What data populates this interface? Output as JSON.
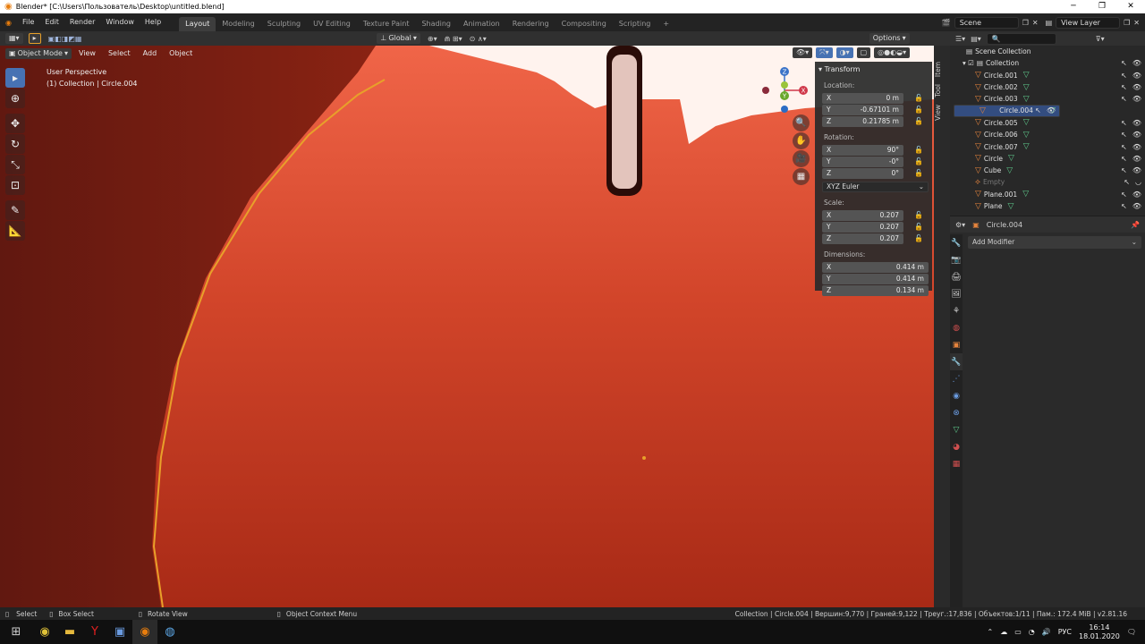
{
  "window": {
    "title": "Blender* [C:\\Users\\Пользователь\\Desktop\\untitled.blend]"
  },
  "menu": [
    "File",
    "Edit",
    "Render",
    "Window",
    "Help"
  ],
  "workspaces": [
    "Layout",
    "Modeling",
    "Sculpting",
    "UV Editing",
    "Texture Paint",
    "Shading",
    "Animation",
    "Rendering",
    "Compositing",
    "Scripting"
  ],
  "active_workspace": "Layout",
  "header_right": {
    "scene": "Scene",
    "view_layer": "View Layer"
  },
  "tool_header": {
    "orientation": "Global",
    "options": "Options"
  },
  "viewport": {
    "mode": "Object Mode",
    "menus": [
      "View",
      "Select",
      "Add",
      "Object"
    ],
    "info_line1": "User Perspective",
    "info_line2": "(1) Collection | Circle.004"
  },
  "gizmo": {
    "z": "Z",
    "y": "Y",
    "x": "X"
  },
  "npanel": {
    "title": "Transform",
    "location_label": "Location:",
    "location": [
      {
        "axis": "X",
        "value": "0 m"
      },
      {
        "axis": "Y",
        "value": "-0.67101 m"
      },
      {
        "axis": "Z",
        "value": "0.21785 m"
      }
    ],
    "rotation_label": "Rotation:",
    "rotation": [
      {
        "axis": "X",
        "value": "90°"
      },
      {
        "axis": "Y",
        "value": "-0°"
      },
      {
        "axis": "Z",
        "value": "0°"
      }
    ],
    "rotation_mode": "XYZ Euler",
    "scale_label": "Scale:",
    "scale": [
      {
        "axis": "X",
        "value": "0.207"
      },
      {
        "axis": "Y",
        "value": "0.207"
      },
      {
        "axis": "Z",
        "value": "0.207"
      }
    ],
    "dimensions_label": "Dimensions:",
    "dimensions": [
      {
        "axis": "X",
        "value": "0.414 m"
      },
      {
        "axis": "Y",
        "value": "0.414 m"
      },
      {
        "axis": "Z",
        "value": "0.134 m"
      }
    ],
    "tabs": [
      "Item",
      "Tool",
      "View"
    ]
  },
  "outliner": {
    "root": "Scene Collection",
    "collection": "Collection",
    "items": [
      "Circle.001",
      "Circle.002",
      "Circle.003",
      "Circle.004",
      "Circle.005",
      "Circle.006",
      "Circle.007",
      "Circle",
      "Cube",
      "Empty",
      "Plane.001",
      "Plane"
    ],
    "selected": "Circle.004"
  },
  "properties": {
    "object": "Circle.004",
    "add_modifier": "Add Modifier"
  },
  "statusbar": {
    "select": "Select",
    "box_select": "Box Select",
    "rotate_view": "Rotate View",
    "context_menu": "Object Context Menu",
    "stats": "Collection | Circle.004 | Вершин:9,770 | Граней:9,122 | Треуг.:17,836 | Объектов:1/11 | Пам.: 172.4 MiB | v2.81.16"
  },
  "taskbar": {
    "lang": "РУС",
    "time": "16:14",
    "date": "18.01.2020"
  },
  "colors": {
    "accent": "#4772b3",
    "viewport_bg": "#c2311b",
    "selection_outline": "#e8a02a"
  }
}
